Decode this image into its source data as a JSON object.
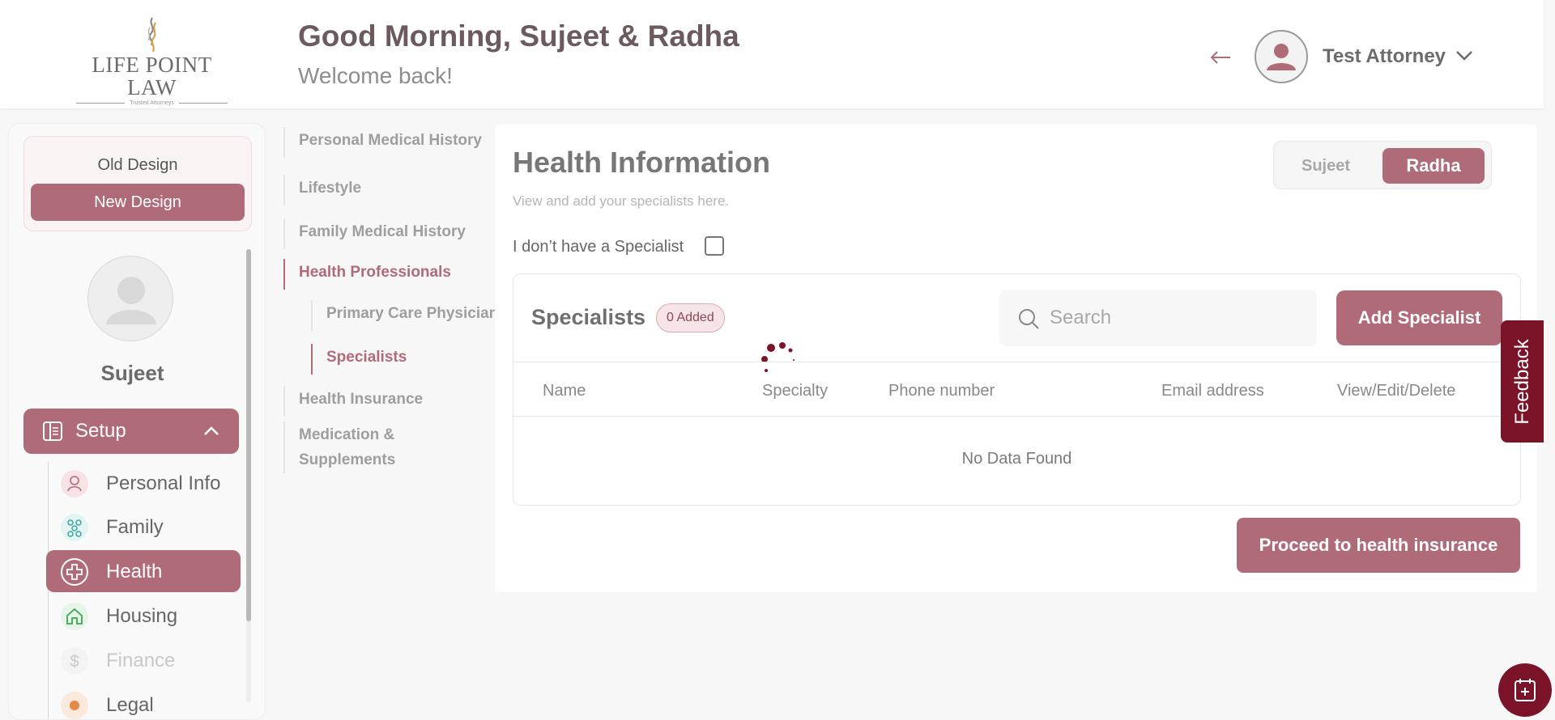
{
  "header": {
    "logo_text": "LIFE POINT LAW",
    "logo_tagline": "Trusted Attorneys",
    "greeting": "Good Morning, Sujeet & Radha",
    "welcome": "Welcome back!",
    "user_name": "Test Attorney"
  },
  "sidebar": {
    "old_design": "Old Design",
    "new_design": "New Design",
    "profile_name": "Sujeet",
    "setup_label": "Setup",
    "items": [
      {
        "label": "Personal Info",
        "icon": "user-icon",
        "state": "normal"
      },
      {
        "label": "Family",
        "icon": "family-icon",
        "state": "normal"
      },
      {
        "label": "Health",
        "icon": "health-plus-icon",
        "state": "active"
      },
      {
        "label": "Housing",
        "icon": "home-icon",
        "state": "normal"
      },
      {
        "label": "Finance",
        "icon": "dollar-icon",
        "state": "disabled"
      },
      {
        "label": "Legal",
        "icon": "legal-icon",
        "state": "normal"
      }
    ]
  },
  "subnav": {
    "items": [
      {
        "label": "Personal Medical History"
      },
      {
        "label": "Lifestyle"
      },
      {
        "label": "Family Medical History"
      },
      {
        "label": "Health Professionals"
      },
      {
        "label": "Primary Care Physician"
      },
      {
        "label": "Specialists"
      },
      {
        "label": "Health Insurance"
      },
      {
        "label": "Medication &"
      },
      {
        "label": "Supplements"
      }
    ]
  },
  "main": {
    "title": "Health Information",
    "subtitle": "View and add your specialists here.",
    "toggle": {
      "option1": "Sujeet",
      "option2": "Radha",
      "selected": "Radha"
    },
    "no_specialist_label": "I don’t have a Specialist",
    "no_specialist_checked": false,
    "specialists": {
      "title": "Specialists",
      "badge": "0 Added",
      "search_placeholder": "Search",
      "add_button": "Add Specialist",
      "columns": [
        "Name",
        "Specialty",
        "Phone number",
        "Email address",
        "View/Edit/Delete"
      ],
      "empty_text": "No Data Found"
    },
    "proceed_button": "Proceed to health insurance"
  },
  "feedback_label": "Feedback",
  "colors": {
    "accent": "#b06b78",
    "dark_accent": "#7b1428"
  }
}
